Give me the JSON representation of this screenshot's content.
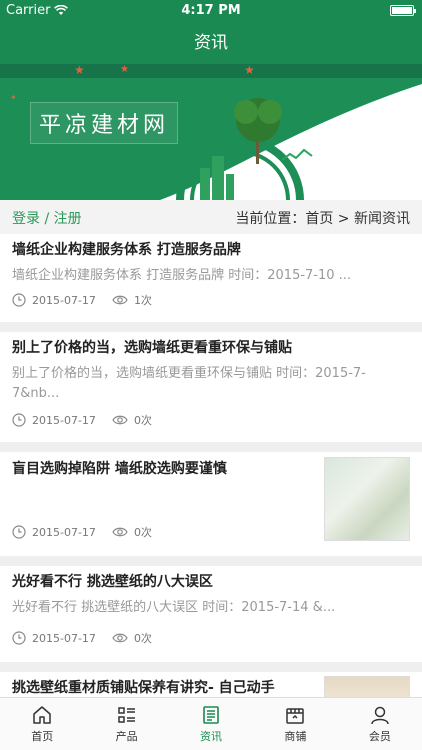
{
  "status_bar": {
    "carrier": "Carrier",
    "time": "4:17 PM"
  },
  "nav": {
    "title": "资讯"
  },
  "banner": {
    "title": "平凉建材网"
  },
  "crumbs": {
    "login": "登录 / 注册",
    "location": "当前位置：首页 > 新闻资讯"
  },
  "articles": [
    {
      "title": "墙纸企业构建服务体系 打造服务品牌",
      "summary": "墙纸企业构建服务体系 打造服务品牌 时间：2015-7-10 ...",
      "date": "2015-07-17",
      "views": "1次"
    },
    {
      "title": "别上了价格的当，选购墙纸更看重环保与铺贴",
      "summary": "别上了价格的当，选购墙纸更看重环保与铺贴 时间：2015-7-7&nb...",
      "date": "2015-07-17",
      "views": "0次"
    },
    {
      "title": "盲目选购掉陷阱 墙纸胶选购要谨慎",
      "date": "2015-07-17",
      "views": "0次"
    },
    {
      "title": "光好看不行 挑选壁纸的八大误区",
      "summary": "光好看不行 挑选壁纸的八大误区 时间：2015-7-14 &...",
      "date": "2015-07-17",
      "views": "0次"
    },
    {
      "title": "挑选壁纸重材质铺贴保养有讲究- 自己动手"
    }
  ],
  "tabs": [
    {
      "label": "首页",
      "icon": "home-icon"
    },
    {
      "label": "产品",
      "icon": "list-icon"
    },
    {
      "label": "资讯",
      "icon": "news-icon",
      "active": true
    },
    {
      "label": "商铺",
      "icon": "shop-icon"
    },
    {
      "label": "会员",
      "icon": "user-icon"
    }
  ],
  "colors": {
    "brand": "#1a8a52",
    "accent_text": "#2a9a56"
  }
}
